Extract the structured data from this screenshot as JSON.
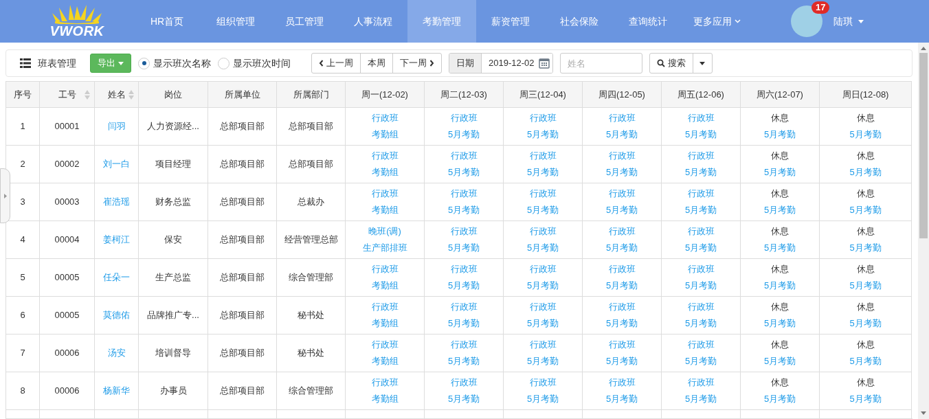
{
  "brand": {
    "logo_text": "VWORK"
  },
  "nav": [
    {
      "label": "HR首页",
      "selected": false,
      "has_menu": false
    },
    {
      "label": "组织管理",
      "selected": false,
      "has_menu": false
    },
    {
      "label": "员工管理",
      "selected": false,
      "has_menu": false
    },
    {
      "label": "人事流程",
      "selected": false,
      "has_menu": false
    },
    {
      "label": "考勤管理",
      "selected": true,
      "has_menu": false
    },
    {
      "label": "薪资管理",
      "selected": false,
      "has_menu": false
    },
    {
      "label": "社会保险",
      "selected": false,
      "has_menu": false
    },
    {
      "label": "查询统计",
      "selected": false,
      "has_menu": false
    },
    {
      "label": "更多应用",
      "selected": false,
      "has_menu": true
    }
  ],
  "user": {
    "name": "陆琪",
    "badge": "17"
  },
  "toolbar": {
    "title": "班表管理",
    "export_button": "导出",
    "display_options": [
      {
        "label": "显示班次名称",
        "selected": true
      },
      {
        "label": "显示班次时间",
        "selected": false
      }
    ],
    "week_buttons": [
      {
        "label": "上一周",
        "kind": "prev"
      },
      {
        "label": "本周",
        "kind": "plain"
      },
      {
        "label": "下一周",
        "kind": "next"
      }
    ],
    "date_label": "日期",
    "date_value": "2019-12-02",
    "name_placeholder": "姓名",
    "search_button": "搜索"
  },
  "table": {
    "columns": [
      {
        "label": "序号",
        "sortable": false
      },
      {
        "label": "工号",
        "sortable": true
      },
      {
        "label": "姓名",
        "sortable": true
      },
      {
        "label": "岗位",
        "sortable": false
      },
      {
        "label": "所属单位",
        "sortable": false
      },
      {
        "label": "所属部门",
        "sortable": false
      },
      {
        "label": "周一(12-02)",
        "sortable": false
      },
      {
        "label": "周二(12-03)",
        "sortable": false
      },
      {
        "label": "周三(12-04)",
        "sortable": false
      },
      {
        "label": "周四(12-05)",
        "sortable": false
      },
      {
        "label": "周五(12-06)",
        "sortable": false
      },
      {
        "label": "周六(12-07)",
        "sortable": false
      },
      {
        "label": "周日(12-08)",
        "sortable": false
      }
    ],
    "rows": [
      {
        "no": "1",
        "id": "00001",
        "name": "闫羽",
        "position": "人力资源经...",
        "unit": "总部项目部",
        "dept": "总部项目部",
        "days": [
          {
            "shift": "行政班",
            "kind": "work",
            "group": "考勤组"
          },
          {
            "shift": "行政班",
            "kind": "work",
            "group": "5月考勤"
          },
          {
            "shift": "行政班",
            "kind": "work",
            "group": "5月考勤"
          },
          {
            "shift": "行政班",
            "kind": "work",
            "group": "5月考勤"
          },
          {
            "shift": "行政班",
            "kind": "work",
            "group": "5月考勤"
          },
          {
            "shift": "休息",
            "kind": "rest",
            "group": "5月考勤"
          },
          {
            "shift": "休息",
            "kind": "rest",
            "group": "5月考勤"
          }
        ]
      },
      {
        "no": "2",
        "id": "00002",
        "name": "刘一白",
        "position": "项目经理",
        "unit": "总部项目部",
        "dept": "总部项目部",
        "days": [
          {
            "shift": "行政班",
            "kind": "work",
            "group": "考勤组"
          },
          {
            "shift": "行政班",
            "kind": "work",
            "group": "5月考勤"
          },
          {
            "shift": "行政班",
            "kind": "work",
            "group": "5月考勤"
          },
          {
            "shift": "行政班",
            "kind": "work",
            "group": "5月考勤"
          },
          {
            "shift": "行政班",
            "kind": "work",
            "group": "5月考勤"
          },
          {
            "shift": "休息",
            "kind": "rest",
            "group": "5月考勤"
          },
          {
            "shift": "休息",
            "kind": "rest",
            "group": "5月考勤"
          }
        ]
      },
      {
        "no": "3",
        "id": "00003",
        "name": "崔浩瑶",
        "position": "财务总监",
        "unit": "总部项目部",
        "dept": "总裁办",
        "days": [
          {
            "shift": "行政班",
            "kind": "work",
            "group": "考勤组"
          },
          {
            "shift": "行政班",
            "kind": "work",
            "group": "5月考勤"
          },
          {
            "shift": "行政班",
            "kind": "work",
            "group": "5月考勤"
          },
          {
            "shift": "行政班",
            "kind": "work",
            "group": "5月考勤"
          },
          {
            "shift": "行政班",
            "kind": "work",
            "group": "5月考勤"
          },
          {
            "shift": "休息",
            "kind": "rest",
            "group": "5月考勤"
          },
          {
            "shift": "休息",
            "kind": "rest",
            "group": "5月考勤"
          }
        ]
      },
      {
        "no": "4",
        "id": "00004",
        "name": "姜柯江",
        "position": "保安",
        "unit": "总部项目部",
        "dept": "经营管理总部",
        "days": [
          {
            "shift": "晚班(调)",
            "kind": "work",
            "group": "生产部排班"
          },
          {
            "shift": "行政班",
            "kind": "work",
            "group": "5月考勤"
          },
          {
            "shift": "行政班",
            "kind": "work",
            "group": "5月考勤"
          },
          {
            "shift": "行政班",
            "kind": "work",
            "group": "5月考勤"
          },
          {
            "shift": "行政班",
            "kind": "work",
            "group": "5月考勤"
          },
          {
            "shift": "休息",
            "kind": "rest",
            "group": "5月考勤"
          },
          {
            "shift": "休息",
            "kind": "rest",
            "group": "5月考勤"
          }
        ]
      },
      {
        "no": "5",
        "id": "00005",
        "name": "任朵一",
        "position": "生产总监",
        "unit": "总部项目部",
        "dept": "综合管理部",
        "days": [
          {
            "shift": "行政班",
            "kind": "work",
            "group": "考勤组"
          },
          {
            "shift": "行政班",
            "kind": "work",
            "group": "5月考勤"
          },
          {
            "shift": "行政班",
            "kind": "work",
            "group": "5月考勤"
          },
          {
            "shift": "行政班",
            "kind": "work",
            "group": "5月考勤"
          },
          {
            "shift": "行政班",
            "kind": "work",
            "group": "5月考勤"
          },
          {
            "shift": "休息",
            "kind": "rest",
            "group": "5月考勤"
          },
          {
            "shift": "休息",
            "kind": "rest",
            "group": "5月考勤"
          }
        ]
      },
      {
        "no": "6",
        "id": "00005",
        "name": "莫德佑",
        "position": "品牌推广专...",
        "unit": "总部项目部",
        "dept": "秘书处",
        "days": [
          {
            "shift": "行政班",
            "kind": "work",
            "group": "考勤组"
          },
          {
            "shift": "行政班",
            "kind": "work",
            "group": "5月考勤"
          },
          {
            "shift": "行政班",
            "kind": "work",
            "group": "5月考勤"
          },
          {
            "shift": "行政班",
            "kind": "work",
            "group": "5月考勤"
          },
          {
            "shift": "行政班",
            "kind": "work",
            "group": "5月考勤"
          },
          {
            "shift": "休息",
            "kind": "rest",
            "group": "5月考勤"
          },
          {
            "shift": "休息",
            "kind": "rest",
            "group": "5月考勤"
          }
        ]
      },
      {
        "no": "7",
        "id": "00006",
        "name": "汤安",
        "position": "培训督导",
        "unit": "总部项目部",
        "dept": "秘书处",
        "days": [
          {
            "shift": "行政班",
            "kind": "work",
            "group": "考勤组"
          },
          {
            "shift": "行政班",
            "kind": "work",
            "group": "5月考勤"
          },
          {
            "shift": "行政班",
            "kind": "work",
            "group": "5月考勤"
          },
          {
            "shift": "行政班",
            "kind": "work",
            "group": "5月考勤"
          },
          {
            "shift": "行政班",
            "kind": "work",
            "group": "5月考勤"
          },
          {
            "shift": "休息",
            "kind": "rest",
            "group": "5月考勤"
          },
          {
            "shift": "休息",
            "kind": "rest",
            "group": "5月考勤"
          }
        ]
      },
      {
        "no": "8",
        "id": "00006",
        "name": "杨新华",
        "position": "办事员",
        "unit": "总部项目部",
        "dept": "综合管理部",
        "days": [
          {
            "shift": "行政班",
            "kind": "work",
            "group": "考勤组"
          },
          {
            "shift": "行政班",
            "kind": "work",
            "group": "5月考勤"
          },
          {
            "shift": "行政班",
            "kind": "work",
            "group": "5月考勤"
          },
          {
            "shift": "行政班",
            "kind": "work",
            "group": "5月考勤"
          },
          {
            "shift": "行政班",
            "kind": "work",
            "group": "5月考勤"
          },
          {
            "shift": "休息",
            "kind": "rest",
            "group": "5月考勤"
          },
          {
            "shift": "休息",
            "kind": "rest",
            "group": "5月考勤"
          }
        ]
      }
    ]
  }
}
